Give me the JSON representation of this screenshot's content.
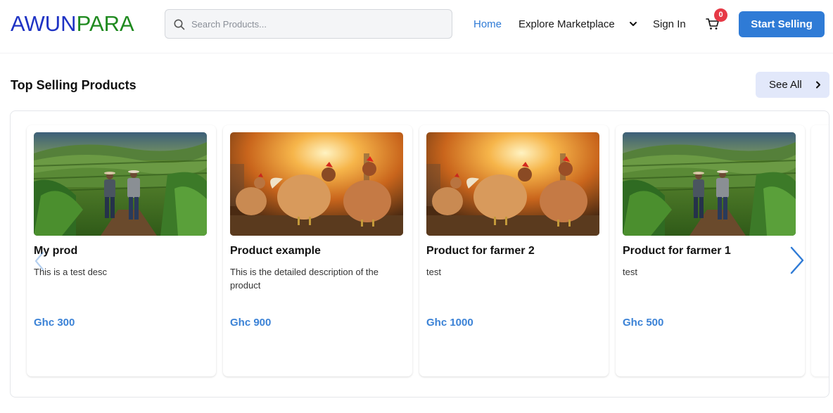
{
  "header": {
    "logo_part1": "AWUN",
    "logo_part2": "PARA",
    "search_placeholder": "Search Products...",
    "nav_home": "Home",
    "nav_explore": "Explore Marketplace",
    "nav_signin": "Sign In",
    "cart_count": "0",
    "start_selling": "Start Selling"
  },
  "section": {
    "title": "Top Selling Products",
    "see_all": "See All"
  },
  "products": [
    {
      "name": "My prod",
      "description": "This is a test desc",
      "price": "Ghc 300",
      "image": "farm-field-image"
    },
    {
      "name": "Product example",
      "description": "This is the detailed description of the product",
      "price": "Ghc 900",
      "image": "chickens-image"
    },
    {
      "name": "Product for farmer 2",
      "description": "test",
      "price": "Ghc 1000",
      "image": "chickens-image"
    },
    {
      "name": "Product for farmer 1",
      "description": "test",
      "price": "Ghc 500",
      "image": "farm-field-image"
    }
  ],
  "colors": {
    "brand_blue": "#1f33c4",
    "brand_green": "#1f8a1f",
    "accent": "#2f7bd6",
    "price": "#3b82d6",
    "badge": "#e63946"
  }
}
